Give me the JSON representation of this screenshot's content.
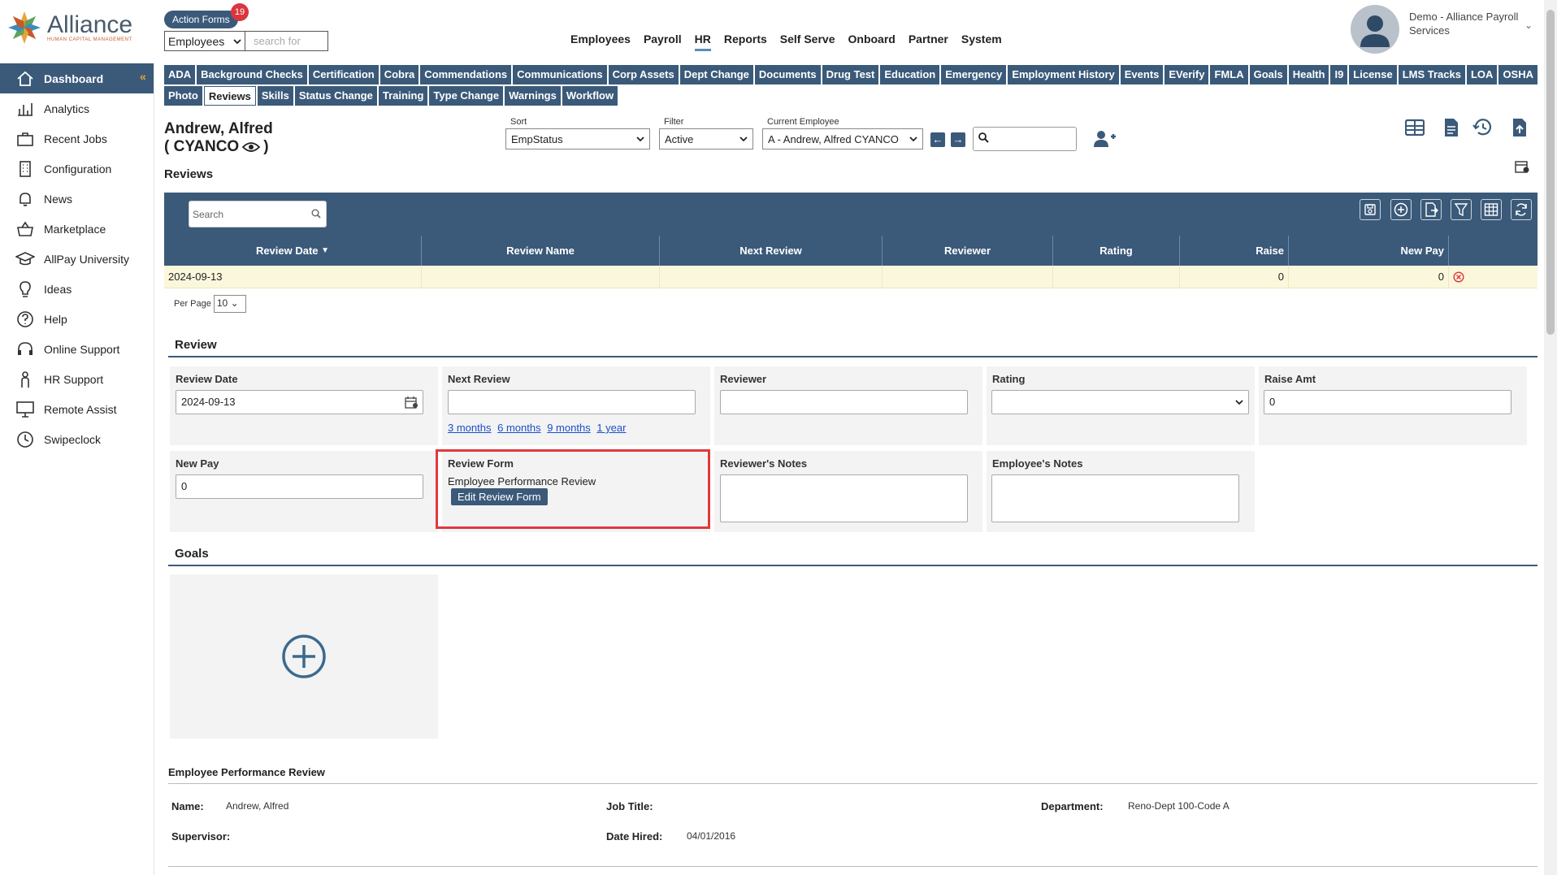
{
  "header": {
    "logo_word": "Alliance",
    "logo_sub": "HUMAN CAPITAL MANAGEMENT",
    "action_forms_label": "Action Forms",
    "action_forms_count": "19",
    "module_select": "Employees",
    "search_placeholder": "search for",
    "nav": [
      "Employees",
      "Payroll",
      "HR",
      "Reports",
      "Self Serve",
      "Onboard",
      "Partner",
      "System"
    ],
    "active_nav": "HR",
    "user_name": "Demo - Alliance Payroll Services"
  },
  "sidebar": {
    "items": [
      {
        "label": "Dashboard",
        "icon": "home-icon"
      },
      {
        "label": "Analytics",
        "icon": "analytics-icon"
      },
      {
        "label": "Recent Jobs",
        "icon": "briefcase-icon"
      },
      {
        "label": "Configuration",
        "icon": "building-icon"
      },
      {
        "label": "News",
        "icon": "bell-icon"
      },
      {
        "label": "Marketplace",
        "icon": "basket-icon"
      },
      {
        "label": "AllPay University",
        "icon": "graduation-cap-icon"
      },
      {
        "label": "Ideas",
        "icon": "lightbulb-icon"
      },
      {
        "label": "Help",
        "icon": "question-icon"
      },
      {
        "label": "Online Support",
        "icon": "headset-icon"
      },
      {
        "label": "HR Support",
        "icon": "person-icon"
      },
      {
        "label": "Remote Assist",
        "icon": "monitor-icon"
      },
      {
        "label": "Swipeclock",
        "icon": "clock-icon"
      }
    ]
  },
  "tabs": {
    "row1": [
      "ADA",
      "Background Checks",
      "Certification",
      "Cobra",
      "Commendations",
      "Communications",
      "Corp Assets",
      "Dept Change",
      "Documents",
      "Drug Test",
      "Education",
      "Emergency",
      "Employment History",
      "Events",
      "EVerify",
      "FMLA",
      "Goals",
      "Health",
      "I9",
      "License",
      "LMS Tracks",
      "LOA",
      "OSHA"
    ],
    "row2": [
      "Photo",
      "Reviews",
      "Skills",
      "Status Change",
      "Training",
      "Type Change",
      "Warnings",
      "Workflow"
    ],
    "active": "Reviews"
  },
  "employee": {
    "name_line1": "Andrew, Alfred",
    "name_line2": "( CYANCO",
    "name_line2_end": ")",
    "sort_label": "Sort",
    "sort_value": "EmpStatus",
    "filter_label": "Filter",
    "filter_value": "Active",
    "current_label": "Current Employee",
    "current_value": "A - Andrew, Alfred CYANCO"
  },
  "reviews_grid": {
    "title": "Reviews",
    "search_placeholder": "Search",
    "columns": [
      "Review Date",
      "Review Name",
      "Next Review",
      "Reviewer",
      "Rating",
      "Raise",
      "New Pay",
      ""
    ],
    "sort_indicator": "▼",
    "rows": [
      {
        "review_date": "2024-09-13",
        "review_name": "",
        "next_review": "",
        "reviewer": "",
        "rating": "",
        "raise": "0",
        "new_pay": "0"
      }
    ],
    "per_page_label": "Per Page",
    "per_page_value": "10"
  },
  "review_form": {
    "title": "Review",
    "review_date_label": "Review Date",
    "review_date_value": "2024-09-13",
    "next_review_label": "Next Review",
    "next_review_value": "",
    "next_review_links": [
      "3 months",
      "6 months",
      "9 months",
      "1 year"
    ],
    "reviewer_label": "Reviewer",
    "rating_label": "Rating",
    "raise_amt_label": "Raise Amt",
    "raise_amt_value": "0",
    "new_pay_label": "New Pay",
    "new_pay_value": "0",
    "review_form_label": "Review Form",
    "review_form_value": "Employee Performance Review",
    "edit_button": "Edit Review Form",
    "reviewer_notes_label": "Reviewer's Notes",
    "employee_notes_label": "Employee's Notes"
  },
  "goals": {
    "title": "Goals"
  },
  "performance": {
    "title": "Employee Performance Review",
    "name_label": "Name:",
    "name_value": "Andrew, Alfred",
    "job_title_label": "Job Title:",
    "job_title_value": "",
    "department_label": "Department:",
    "department_value": "Reno-Dept 100-Code A",
    "supervisor_label": "Supervisor:",
    "supervisor_value": "",
    "date_hired_label": "Date Hired:",
    "date_hired_value": "04/01/2016"
  },
  "colors": {
    "primary": "#3b5a7a",
    "highlight": "#e0393e",
    "row_bg": "#fbf7dc",
    "badge": "#d9363e",
    "link": "#1a4fc9"
  }
}
